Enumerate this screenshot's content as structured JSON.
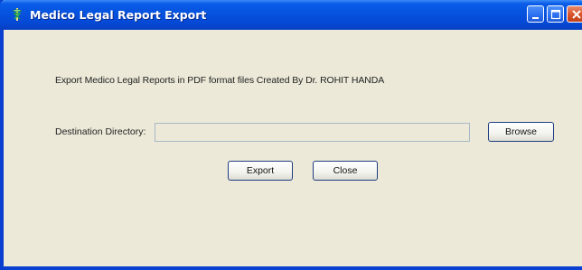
{
  "window": {
    "title": "Medico Legal Report Export",
    "app_icon": "caduceus-icon",
    "controls": {
      "minimize_icon": "minimize-icon",
      "maximize_icon": "maximize-icon",
      "close_icon": "close-icon"
    }
  },
  "content": {
    "intro_text": "Export Medico Legal Reports in PDF format files Created By Dr. ROHIT HANDA",
    "destination_label": "Destination Directory:",
    "destination_value": "",
    "browse_label": "Browse",
    "export_label": "Export",
    "close_label": "Close"
  },
  "colors": {
    "titlebar": "#0654e0",
    "window_bg": "#ece9d8",
    "close_button": "#d9532a"
  }
}
